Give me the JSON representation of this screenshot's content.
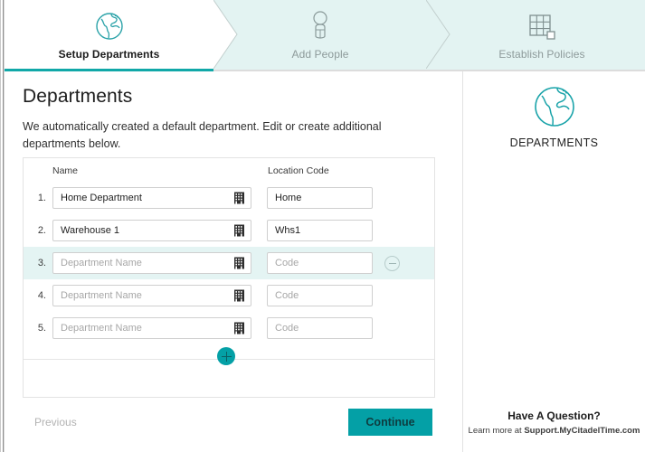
{
  "stepper": {
    "steps": [
      {
        "label": "Setup Departments",
        "icon": "globe-icon",
        "state": "active"
      },
      {
        "label": "Add People",
        "icon": "person-icon",
        "state": "inactive"
      },
      {
        "label": "Establish Policies",
        "icon": "grid-icon",
        "state": "inactive"
      }
    ]
  },
  "main": {
    "title": "Departments",
    "description": "We automatically created a default department. Edit or create additional departments below.",
    "columns": {
      "name": "Name",
      "location_code": "Location Code"
    },
    "rows": [
      {
        "num": "1.",
        "name_value": "Home Department",
        "name_placeholder": "Department Name",
        "code_value": "Home",
        "code_placeholder": "Code",
        "highlighted": false,
        "removable": false
      },
      {
        "num": "2.",
        "name_value": "Warehouse 1",
        "name_placeholder": "Department Name",
        "code_value": "Whs1",
        "code_placeholder": "Code",
        "highlighted": false,
        "removable": false
      },
      {
        "num": "3.",
        "name_value": "",
        "name_placeholder": "Department Name",
        "code_value": "",
        "code_placeholder": "Code",
        "highlighted": true,
        "removable": true
      },
      {
        "num": "4.",
        "name_value": "",
        "name_placeholder": "Department Name",
        "code_value": "",
        "code_placeholder": "Code",
        "highlighted": false,
        "removable": false
      },
      {
        "num": "5.",
        "name_value": "",
        "name_placeholder": "Department Name",
        "code_value": "",
        "code_placeholder": "Code",
        "highlighted": false,
        "removable": false
      }
    ],
    "add_row_label": "+",
    "previous_label": "Previous",
    "continue_label": "Continue"
  },
  "sidebar": {
    "icon": "globe-icon",
    "title": "DEPARTMENTS",
    "help_title": "Have A Question?",
    "help_prefix": "Learn more at ",
    "help_link": "Support.MyCitadelTime.com"
  },
  "colors": {
    "accent": "#04a0a6",
    "underline": "#11a8a8",
    "step_inactive_bg": "#e3f3f2",
    "row_highlight": "#e4f4f3"
  }
}
